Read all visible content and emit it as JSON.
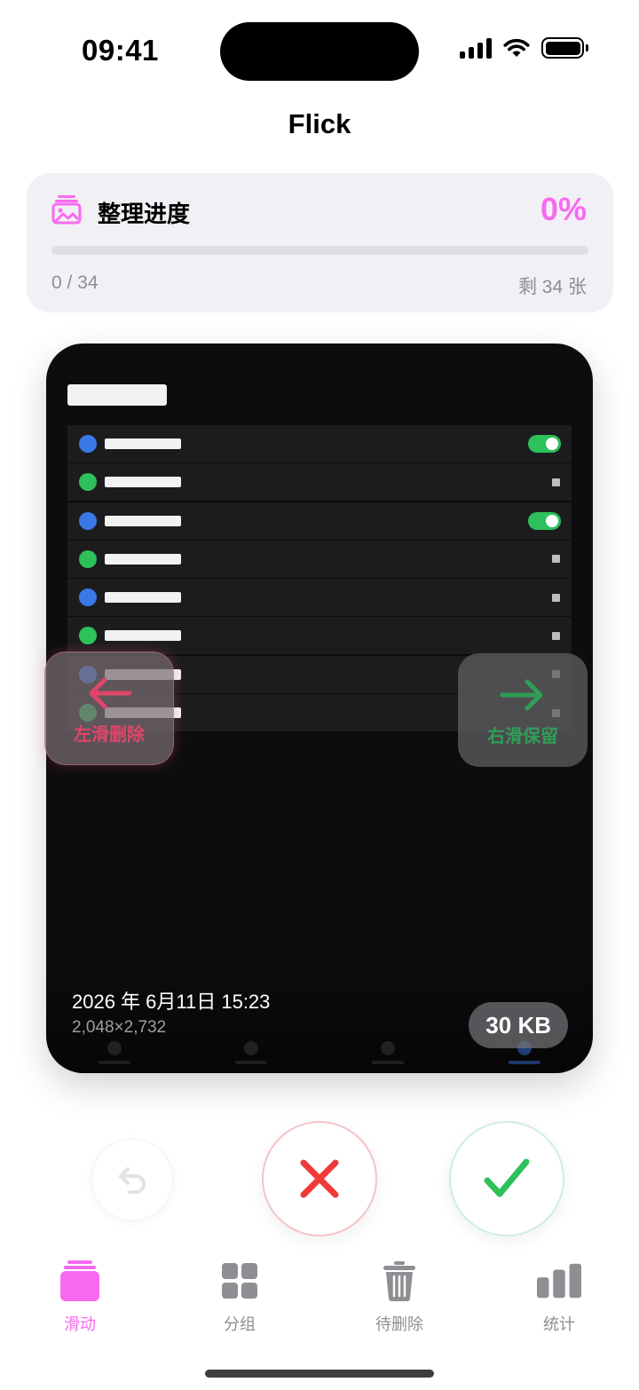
{
  "status_bar": {
    "time": "09:41",
    "icons": [
      "cellular-signal-icon",
      "wifi-icon",
      "battery-icon"
    ]
  },
  "app": {
    "title": "Flick"
  },
  "progress": {
    "icon": "photo-stack-icon",
    "label": "整理进度",
    "percent_text": "0%",
    "fraction": 0,
    "count_text": "0 / 34",
    "remaining_text": "剩 34 张",
    "accent_color": "#f86af0"
  },
  "photo": {
    "date": "2026 年 6月11日 15:23",
    "dimensions": "2,048×2,732",
    "size": "30 KB",
    "content_rows": [
      {
        "dot": "#3b78e7",
        "control": "toggle"
      },
      {
        "dot": "#2ec05a",
        "control": "square"
      },
      {
        "dot": "#3b78e7",
        "control": "toggle"
      },
      {
        "dot": "#2ec05a",
        "control": "square"
      },
      {
        "dot": "#3b78e7",
        "control": "square"
      },
      {
        "dot": "#2ec05a",
        "control": "square"
      },
      {
        "dot": "#3b78e7",
        "control": "square"
      },
      {
        "dot": "#2ec05a",
        "control": "square"
      }
    ]
  },
  "hints": {
    "left": {
      "text": "左滑删除",
      "icon": "arrow-left-icon",
      "color": "#e0456a"
    },
    "right": {
      "text": "右滑保留",
      "icon": "arrow-right-icon",
      "color": "#2f9e56"
    }
  },
  "actions": {
    "undo_icon": "undo-icon",
    "delete_icon": "x-mark-icon",
    "delete_color": "#f03a3a",
    "keep_icon": "checkmark-icon",
    "keep_color": "#2ec05a"
  },
  "tabs": [
    {
      "label": "滑动",
      "icon": "cards-stack-icon",
      "active": true
    },
    {
      "label": "分组",
      "icon": "grid-icon",
      "active": false
    },
    {
      "label": "待删除",
      "icon": "trash-icon",
      "active": false
    },
    {
      "label": "统计",
      "icon": "bar-chart-icon",
      "active": false
    }
  ]
}
